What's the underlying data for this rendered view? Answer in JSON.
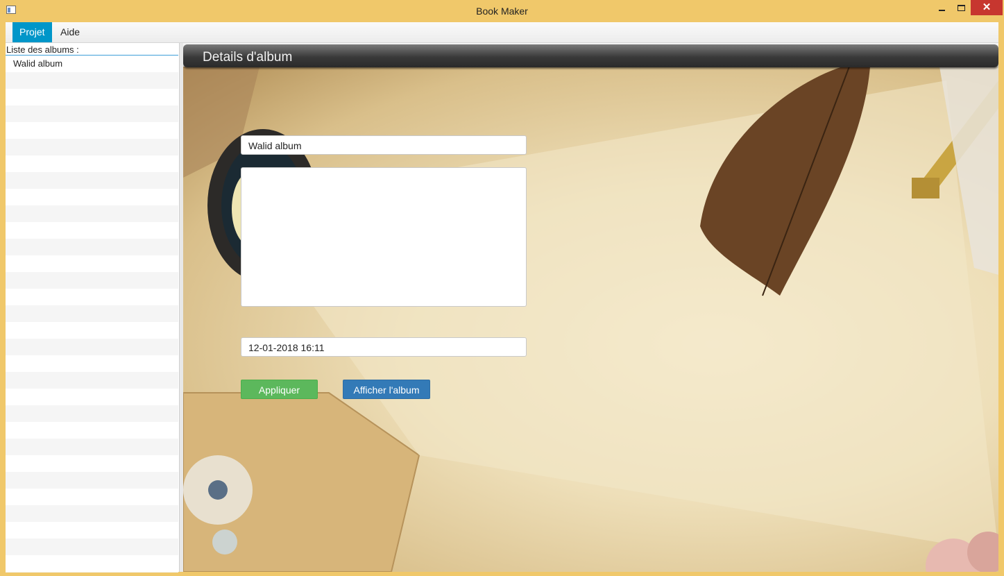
{
  "window": {
    "title": "Book Maker",
    "close_glyph": "✕"
  },
  "menu": {
    "items": [
      {
        "label": "Projet"
      },
      {
        "label": "Aide"
      }
    ]
  },
  "album_list": {
    "label": "Liste des albums :",
    "items": [
      {
        "label": "Walid album"
      }
    ]
  },
  "details": {
    "title": "Details d'album",
    "name_value": "Walid album",
    "description_value": "",
    "date_value": "12-01-2018 16:11",
    "apply_label": "Appliquer",
    "show_album_label": "Afficher l'album"
  },
  "colors": {
    "accent": "#0096c9",
    "apply": "#5cb85c",
    "show_album": "#337ab7",
    "frame": "#f0c86a",
    "close": "#c7362f"
  }
}
